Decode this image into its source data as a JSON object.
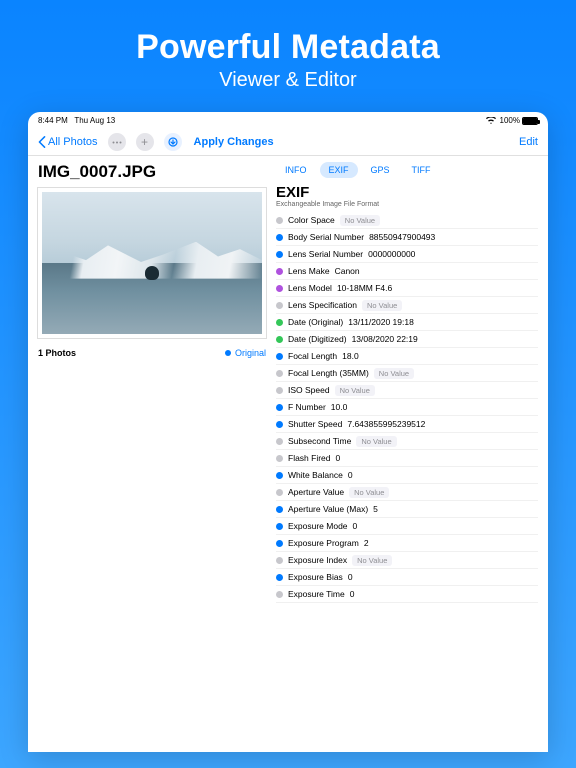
{
  "hero": {
    "title": "Powerful Metadata",
    "subtitle": "Viewer & Editor"
  },
  "statusbar": {
    "time": "8:44 PM",
    "date": "Thu Aug 13",
    "battery": "100%"
  },
  "toolbar": {
    "back": "All Photos",
    "apply": "Apply Changes",
    "edit": "Edit"
  },
  "page": {
    "title": "IMG_0007.JPG",
    "count": "1 Photos",
    "original": "Original"
  },
  "tabs": {
    "info": "INFO",
    "exif": "EXIF",
    "gps": "GPS",
    "tiff": "TIFF"
  },
  "section": {
    "title": "EXIF",
    "subtitle": "Exchangeable Image File Format"
  },
  "novalue": "No Value",
  "rows": [
    {
      "dot": "#c7c7cc",
      "label": "Color Space",
      "value": null
    },
    {
      "dot": "#007aff",
      "label": "Body Serial Number",
      "value": "88550947900493"
    },
    {
      "dot": "#007aff",
      "label": "Lens Serial Number",
      "value": "0000000000"
    },
    {
      "dot": "#af52de",
      "label": "Lens Make",
      "value": "Canon"
    },
    {
      "dot": "#af52de",
      "label": "Lens Model",
      "value": "10-18MM F4.6"
    },
    {
      "dot": "#c7c7cc",
      "label": "Lens Specification",
      "value": null
    },
    {
      "dot": "#34c759",
      "label": "Date (Original)",
      "value": "13/11/2020 19:18"
    },
    {
      "dot": "#34c759",
      "label": "Date (Digitized)",
      "value": "13/08/2020 22:19"
    },
    {
      "dot": "#007aff",
      "label": "Focal Length",
      "value": "18.0"
    },
    {
      "dot": "#c7c7cc",
      "label": "Focal Length (35MM)",
      "value": null
    },
    {
      "dot": "#c7c7cc",
      "label": "ISO Speed",
      "value": null
    },
    {
      "dot": "#007aff",
      "label": "F Number",
      "value": "10.0"
    },
    {
      "dot": "#007aff",
      "label": "Shutter Speed",
      "value": "7.643855995239512"
    },
    {
      "dot": "#c7c7cc",
      "label": "Subsecond Time",
      "value": null
    },
    {
      "dot": "#c7c7cc",
      "label": "Flash Fired",
      "value": "0"
    },
    {
      "dot": "#007aff",
      "label": "White Balance",
      "value": "0"
    },
    {
      "dot": "#c7c7cc",
      "label": "Aperture Value",
      "value": null
    },
    {
      "dot": "#007aff",
      "label": "Aperture Value (Max)",
      "value": "5"
    },
    {
      "dot": "#007aff",
      "label": "Exposure Mode",
      "value": "0"
    },
    {
      "dot": "#007aff",
      "label": "Exposure Program",
      "value": "2"
    },
    {
      "dot": "#c7c7cc",
      "label": "Exposure Index",
      "value": null
    },
    {
      "dot": "#007aff",
      "label": "Exposure Bias",
      "value": "0"
    },
    {
      "dot": "#c7c7cc",
      "label": "Exposure Time",
      "value": "0"
    }
  ]
}
